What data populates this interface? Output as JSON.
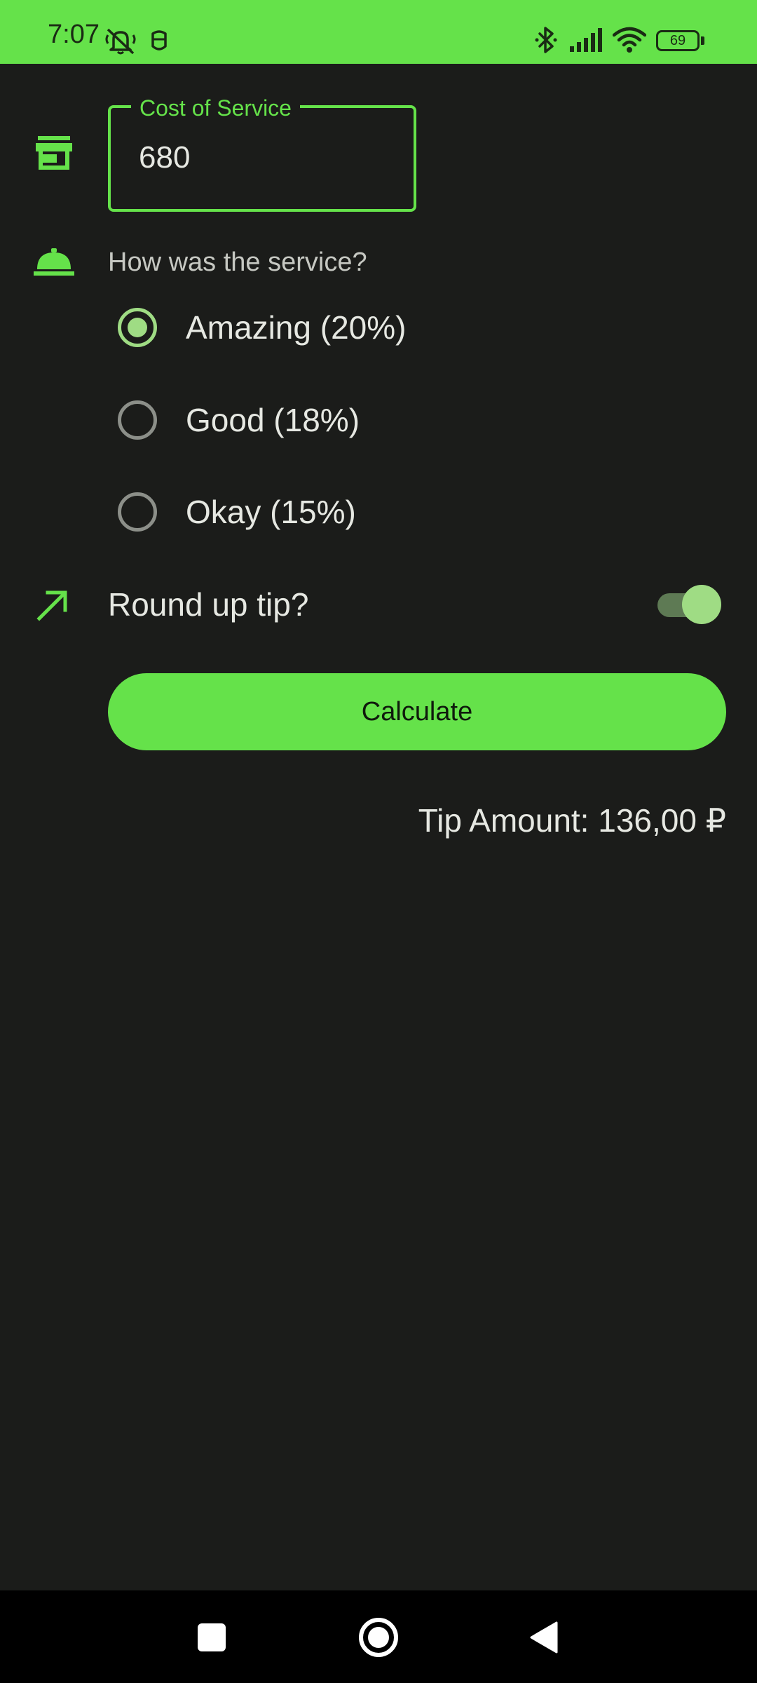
{
  "status_bar": {
    "time": "7:07",
    "battery": "69",
    "background_color": "#65e24a",
    "icons": [
      "do-not-disturb-icon",
      "antivirus-icon",
      "bluetooth-icon",
      "signal-icon",
      "wifi-icon",
      "battery-icon"
    ]
  },
  "form": {
    "cost_field": {
      "label": "Cost of Service",
      "value": "680",
      "icon": "storefront-icon"
    },
    "service_question": {
      "label": "How was the service?",
      "icon": "room-service-bell-icon"
    },
    "tip_options": [
      {
        "label": "Amazing (20%)",
        "selected": true
      },
      {
        "label": "Good (18%)",
        "selected": false
      },
      {
        "label": "Okay (15%)",
        "selected": false
      }
    ],
    "round_up": {
      "label": "Round up tip?",
      "enabled": true,
      "icon": "trending-up-arrow-icon"
    },
    "calculate_label": "Calculate",
    "tip_amount": "Tip Amount: 136,00 ₽"
  },
  "nav_bar": {
    "buttons": [
      "recents-square-icon",
      "home-circle-icon",
      "back-triangle-icon"
    ]
  },
  "colors": {
    "accent": "#65e24a",
    "background": "#1b1c1a",
    "selected_control": "#9fdc84",
    "text_primary": "#e6e8e2",
    "text_secondary": "#c6c8c2"
  }
}
